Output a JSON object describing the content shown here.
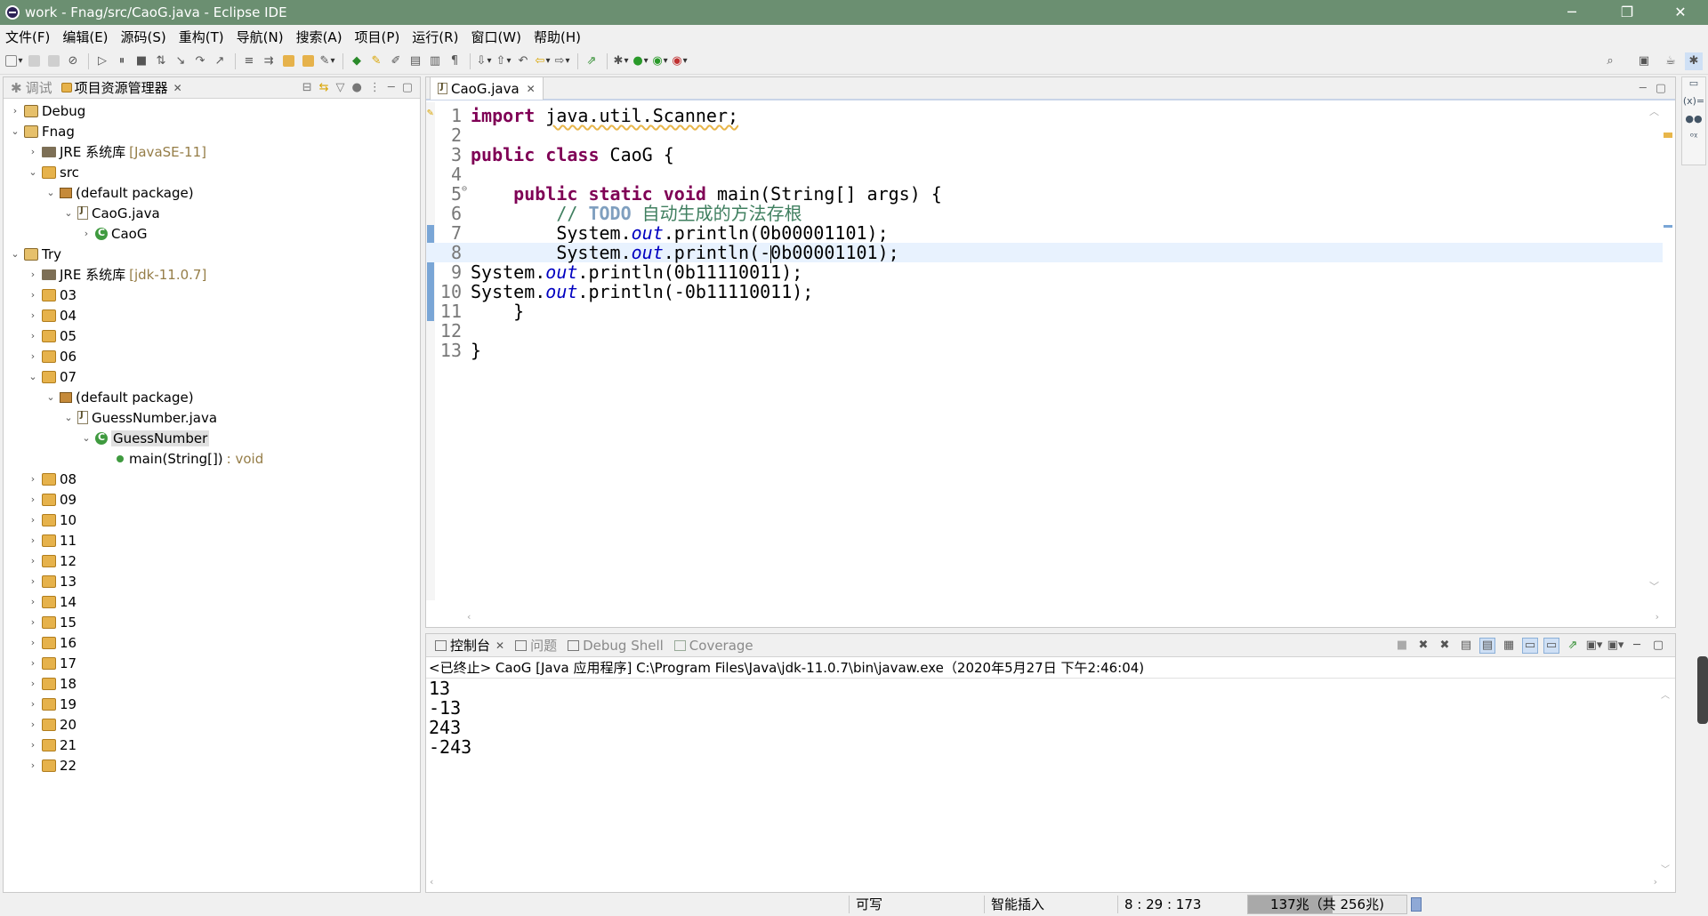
{
  "window": {
    "title": "work - Fnag/src/CaoG.java - Eclipse IDE",
    "minimize": "─",
    "restore": "❐",
    "close": "✕"
  },
  "menu": [
    "文件(F)",
    "编辑(E)",
    "源码(S)",
    "重构(T)",
    "导航(N)",
    "搜索(A)",
    "项目(P)",
    "运行(R)",
    "窗口(W)",
    "帮助(H)"
  ],
  "explorer": {
    "tab_debug": "调试",
    "tab_explorer": "项目资源管理器",
    "items": [
      {
        "label": "Debug",
        "twist": "›",
        "icon": "project",
        "indent": 0
      },
      {
        "label": "Fnag",
        "twist": "⌄",
        "icon": "project",
        "indent": 0
      },
      {
        "label": "JRE 系统库",
        "suffix": "[JavaSE-11]",
        "twist": "›",
        "icon": "jre",
        "indent": 1
      },
      {
        "label": "src",
        "twist": "⌄",
        "icon": "folder",
        "indent": 1
      },
      {
        "label": "(default package)",
        "twist": "⌄",
        "icon": "pkg",
        "indent": 2
      },
      {
        "label": "CaoG.java",
        "twist": "⌄",
        "icon": "java",
        "indent": 3
      },
      {
        "label": "CaoG",
        "twist": "›",
        "icon": "cls",
        "indent": 4
      },
      {
        "label": "Try",
        "twist": "⌄",
        "icon": "project",
        "indent": 0
      },
      {
        "label": "JRE 系统库",
        "suffix": "[jdk-11.0.7]",
        "twist": "›",
        "icon": "jre",
        "indent": 1
      },
      {
        "label": "03",
        "twist": "›",
        "icon": "folder",
        "indent": 1
      },
      {
        "label": "04",
        "twist": "›",
        "icon": "folder",
        "indent": 1
      },
      {
        "label": "05",
        "twist": "›",
        "icon": "folder",
        "indent": 1
      },
      {
        "label": "06",
        "twist": "›",
        "icon": "folder",
        "indent": 1
      },
      {
        "label": "07",
        "twist": "⌄",
        "icon": "folder",
        "indent": 1
      },
      {
        "label": "(default package)",
        "twist": "⌄",
        "icon": "pkg",
        "indent": 2
      },
      {
        "label": "GuessNumber.java",
        "twist": "⌄",
        "icon": "java",
        "indent": 3
      },
      {
        "label": "GuessNumber",
        "twist": "⌄",
        "icon": "cls",
        "indent": 4,
        "selected": true
      },
      {
        "label": "main(String[])",
        "suffix": ": void",
        "twist": "",
        "icon": "method",
        "indent": 5
      },
      {
        "label": "08",
        "twist": "›",
        "icon": "folder",
        "indent": 1
      },
      {
        "label": "09",
        "twist": "›",
        "icon": "folder",
        "indent": 1
      },
      {
        "label": "10",
        "twist": "›",
        "icon": "folder",
        "indent": 1
      },
      {
        "label": "11",
        "twist": "›",
        "icon": "folder",
        "indent": 1
      },
      {
        "label": "12",
        "twist": "›",
        "icon": "folder",
        "indent": 1
      },
      {
        "label": "13",
        "twist": "›",
        "icon": "folder",
        "indent": 1
      },
      {
        "label": "14",
        "twist": "›",
        "icon": "folder",
        "indent": 1
      },
      {
        "label": "15",
        "twist": "›",
        "icon": "folder",
        "indent": 1
      },
      {
        "label": "16",
        "twist": "›",
        "icon": "folder",
        "indent": 1
      },
      {
        "label": "17",
        "twist": "›",
        "icon": "folder",
        "indent": 1
      },
      {
        "label": "18",
        "twist": "›",
        "icon": "folder",
        "indent": 1
      },
      {
        "label": "19",
        "twist": "›",
        "icon": "folder",
        "indent": 1
      },
      {
        "label": "20",
        "twist": "›",
        "icon": "folder",
        "indent": 1
      },
      {
        "label": "21",
        "twist": "›",
        "icon": "folder",
        "indent": 1
      },
      {
        "label": "22",
        "twist": "›",
        "icon": "folder",
        "indent": 1
      }
    ]
  },
  "editor": {
    "tab": "CaoG.java",
    "current_line": 8,
    "lines": [
      {
        "n": "1",
        "tokens": [
          {
            "t": "import",
            "c": "kw"
          },
          {
            "t": " "
          },
          {
            "t": "java.util.Scanner;",
            "c": "imp"
          }
        ]
      },
      {
        "n": "2",
        "tokens": []
      },
      {
        "n": "3",
        "tokens": [
          {
            "t": "public",
            "c": "kw"
          },
          {
            "t": " "
          },
          {
            "t": "class",
            "c": "kw"
          },
          {
            "t": " CaoG {"
          }
        ]
      },
      {
        "n": "4",
        "tokens": []
      },
      {
        "n": "5",
        "tokens": [
          {
            "t": "    "
          },
          {
            "t": "public",
            "c": "kw"
          },
          {
            "t": " "
          },
          {
            "t": "static",
            "c": "kw"
          },
          {
            "t": " "
          },
          {
            "t": "void",
            "c": "kw"
          },
          {
            "t": " main(String[] args) {"
          }
        ]
      },
      {
        "n": "6",
        "tokens": [
          {
            "t": "        "
          },
          {
            "t": "// ",
            "c": "cmt"
          },
          {
            "t": "TODO",
            "c": "todo"
          },
          {
            "t": " 自动生成的方法存根",
            "c": "cmt"
          }
        ]
      },
      {
        "n": "7",
        "tokens": [
          {
            "t": "        System."
          },
          {
            "t": "out",
            "c": "fld"
          },
          {
            "t": ".println(0b00001101);"
          }
        ]
      },
      {
        "n": "8",
        "tokens": [
          {
            "t": "        System."
          },
          {
            "t": "out",
            "c": "fld"
          },
          {
            "t": ".println(-"
          },
          {
            "t": "",
            "c": "caret"
          },
          {
            "t": "0b00001101);"
          }
        ]
      },
      {
        "n": "9",
        "tokens": [
          {
            "t": "System."
          },
          {
            "t": "out",
            "c": "fld"
          },
          {
            "t": ".println(0b11110011);"
          }
        ]
      },
      {
        "n": "10",
        "tokens": [
          {
            "t": "System."
          },
          {
            "t": "out",
            "c": "fld"
          },
          {
            "t": ".println(-0b11110011);"
          }
        ]
      },
      {
        "n": "11",
        "tokens": [
          {
            "t": "    }"
          }
        ]
      },
      {
        "n": "12",
        "tokens": []
      },
      {
        "n": "13",
        "tokens": [
          {
            "t": "}"
          }
        ]
      }
    ]
  },
  "console": {
    "tab_console": "控制台",
    "tab_problems": "问题",
    "tab_debug_shell": "Debug Shell",
    "tab_coverage": "Coverage",
    "header": "<已终止> CaoG [Java 应用程序] C:\\Program Files\\Java\\jdk-11.0.7\\bin\\javaw.exe（2020年5月27日 下午2:46:04)",
    "output": [
      "13",
      "-13",
      "243",
      "-243"
    ]
  },
  "status": {
    "writable": "可写",
    "insert_mode": "智能插入",
    "position": "8 : 29 : 173",
    "heap": "137兆（共 256兆)",
    "heap_used_fraction": 0.535
  },
  "colors": {
    "titlebar": "#6b8f71",
    "keyword": "#7f0055",
    "field": "#0000c0",
    "comment": "#3f7f5f",
    "current_line": "#e8f2fe"
  }
}
